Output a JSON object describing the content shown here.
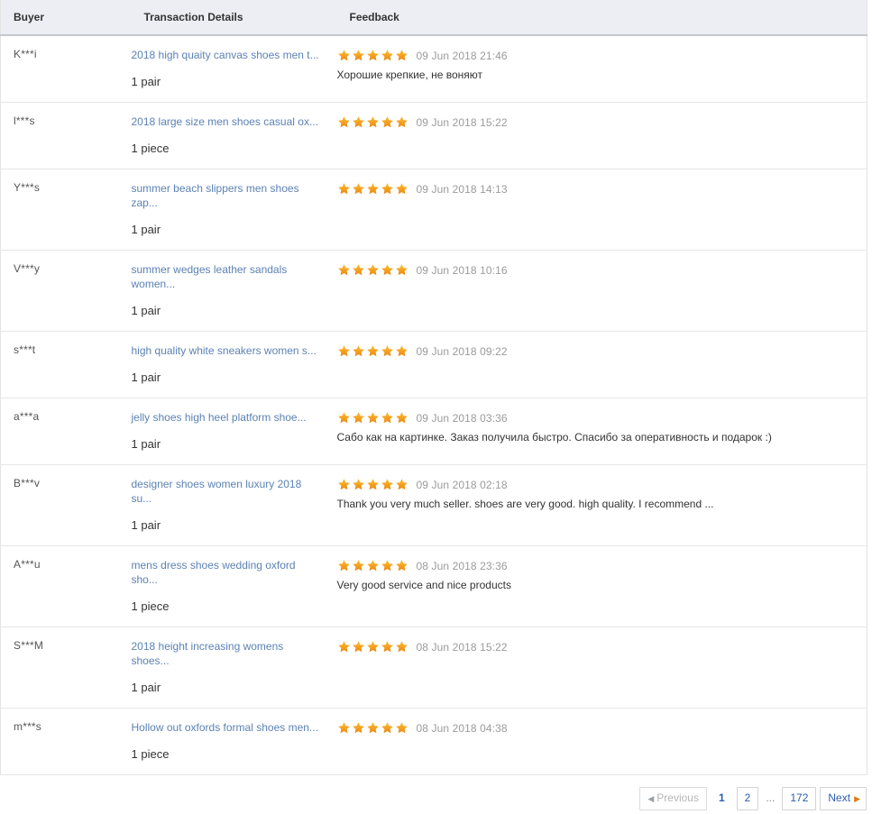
{
  "table": {
    "columns": [
      {
        "key": "buyer",
        "label": "Buyer"
      },
      {
        "key": "details",
        "label": "Transaction Details"
      },
      {
        "key": "feedback",
        "label": "Feedback"
      }
    ],
    "rows": [
      {
        "buyer": "K***i",
        "product": "2018 high quaity canvas shoes men t...",
        "quantity": "1 pair",
        "stars": 5,
        "timestamp": "09 Jun 2018 21:46",
        "comment": "Хорошие крепкие, не воняют"
      },
      {
        "buyer": "l***s",
        "product": "2018 large size men shoes casual ox...",
        "quantity": "1 piece",
        "stars": 5,
        "timestamp": "09 Jun 2018 15:22",
        "comment": ""
      },
      {
        "buyer": "Y***s",
        "product": "summer beach slippers men shoes zap...",
        "quantity": "1 pair",
        "stars": 5,
        "timestamp": "09 Jun 2018 14:13",
        "comment": ""
      },
      {
        "buyer": "V***y",
        "product": "summer wedges leather sandals women...",
        "quantity": "1 pair",
        "stars": 5,
        "timestamp": "09 Jun 2018 10:16",
        "comment": ""
      },
      {
        "buyer": "s***t",
        "product": "high quality white sneakers women s...",
        "quantity": "1 pair",
        "stars": 5,
        "timestamp": "09 Jun 2018 09:22",
        "comment": ""
      },
      {
        "buyer": "a***a",
        "product": "jelly shoes high heel platform shoe...",
        "quantity": "1 pair",
        "stars": 5,
        "timestamp": "09 Jun 2018 03:36",
        "comment": "Сабо как на картинке. Заказ получила быстро. Спасибо за оперативность и подарок :)"
      },
      {
        "buyer": "B***v",
        "product": "designer shoes women luxury 2018 su...",
        "quantity": "1 pair",
        "stars": 5,
        "timestamp": "09 Jun 2018 02:18",
        "comment": "Thank you very much seller. shoes are very good. high quality. I recommend ..."
      },
      {
        "buyer": "A***u",
        "product": "mens dress shoes wedding oxford sho...",
        "quantity": "1 piece",
        "stars": 5,
        "timestamp": "08 Jun 2018 23:36",
        "comment": "Very good service and nice products"
      },
      {
        "buyer": "S***M",
        "product": "2018 height increasing womens shoes...",
        "quantity": "1 pair",
        "stars": 5,
        "timestamp": "08 Jun 2018 15:22",
        "comment": ""
      },
      {
        "buyer": "m***s",
        "product": "Hollow out oxfords formal shoes men...",
        "quantity": "1 piece",
        "stars": 5,
        "timestamp": "08 Jun 2018 04:38",
        "comment": ""
      }
    ]
  },
  "pagination": {
    "previous_label": "Previous",
    "next_label": "Next",
    "ellipsis": "...",
    "pages": [
      "1",
      "2"
    ],
    "last_page": "172",
    "current_page": "1",
    "previous_disabled": true
  },
  "colors": {
    "star": "#f5a524",
    "link": "#5c82b4",
    "header_bg": "#eceef3",
    "timestamp": "#9b9b9b",
    "pager_link": "#2a5db0"
  }
}
